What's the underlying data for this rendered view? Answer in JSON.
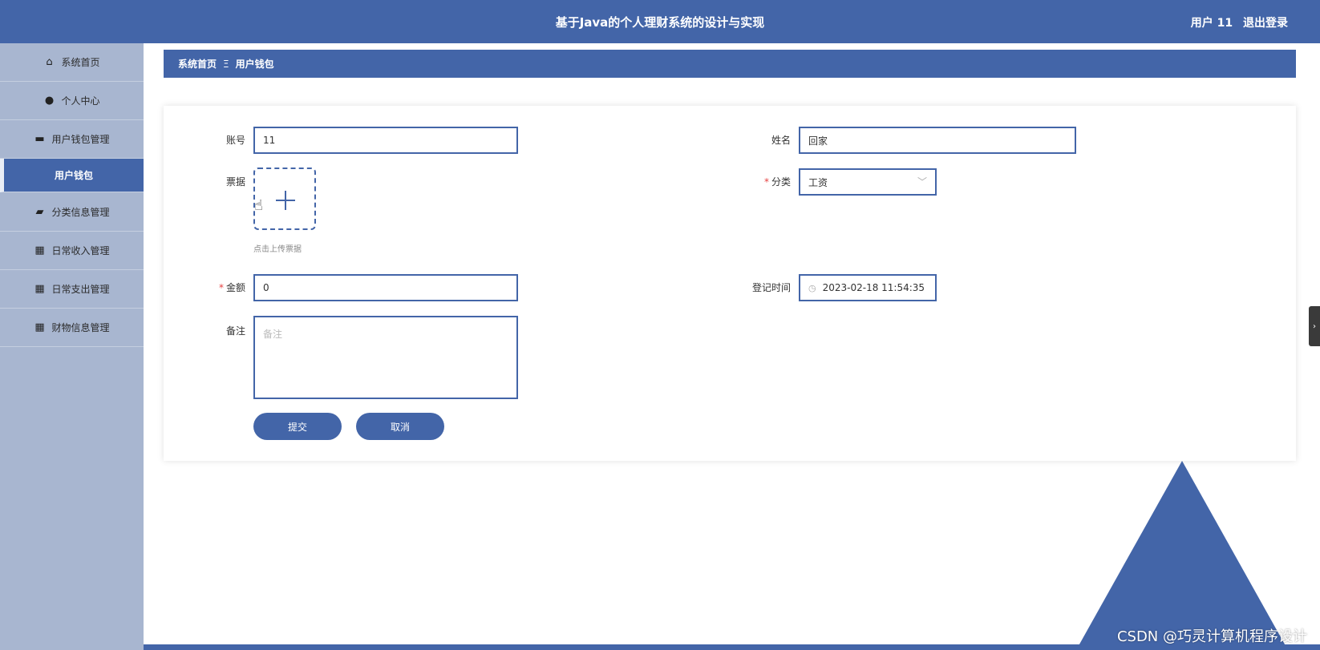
{
  "header": {
    "title": "基于Java的个人理财系统的设计与实现",
    "user": "用户 11",
    "logout": "退出登录"
  },
  "sidebar": {
    "items": [
      {
        "label": "系统首页",
        "icon": "home-icon",
        "glyph": "⌂"
      },
      {
        "label": "个人中心",
        "icon": "user-icon",
        "glyph": "●"
      },
      {
        "label": "用户钱包管理",
        "icon": "chat-icon",
        "glyph": "▬"
      },
      {
        "label": "用户钱包",
        "icon": ""
      },
      {
        "label": "分类信息管理",
        "icon": "briefcase-icon",
        "glyph": "▰"
      },
      {
        "label": "日常收入管理",
        "icon": "grid-icon",
        "glyph": "▦"
      },
      {
        "label": "日常支出管理",
        "icon": "grid-icon",
        "glyph": "▦"
      },
      {
        "label": "财物信息管理",
        "icon": "grid-icon",
        "glyph": "▦"
      }
    ]
  },
  "breadcrumb": {
    "home": "系统首页",
    "separator": "Ξ",
    "current": "用户钱包"
  },
  "form": {
    "account_label": "账号",
    "account_value": "11",
    "name_label": "姓名",
    "name_value": "回家",
    "receipt_label": "票据",
    "receipt_hint": "点击上传票据",
    "category_label": "分类",
    "category_value": "工资",
    "amount_label": "金额",
    "amount_value": "0",
    "time_label": "登记时间",
    "time_value": "2023-02-18 11:54:35",
    "note_label": "备注",
    "note_placeholder": "备注",
    "submit": "提交",
    "cancel": "取消"
  },
  "watermark": "CSDN @巧灵计算机程序设计",
  "colors": {
    "primary": "#4365a8",
    "sidebar": "#a8b6d0",
    "required": "#e64242"
  }
}
